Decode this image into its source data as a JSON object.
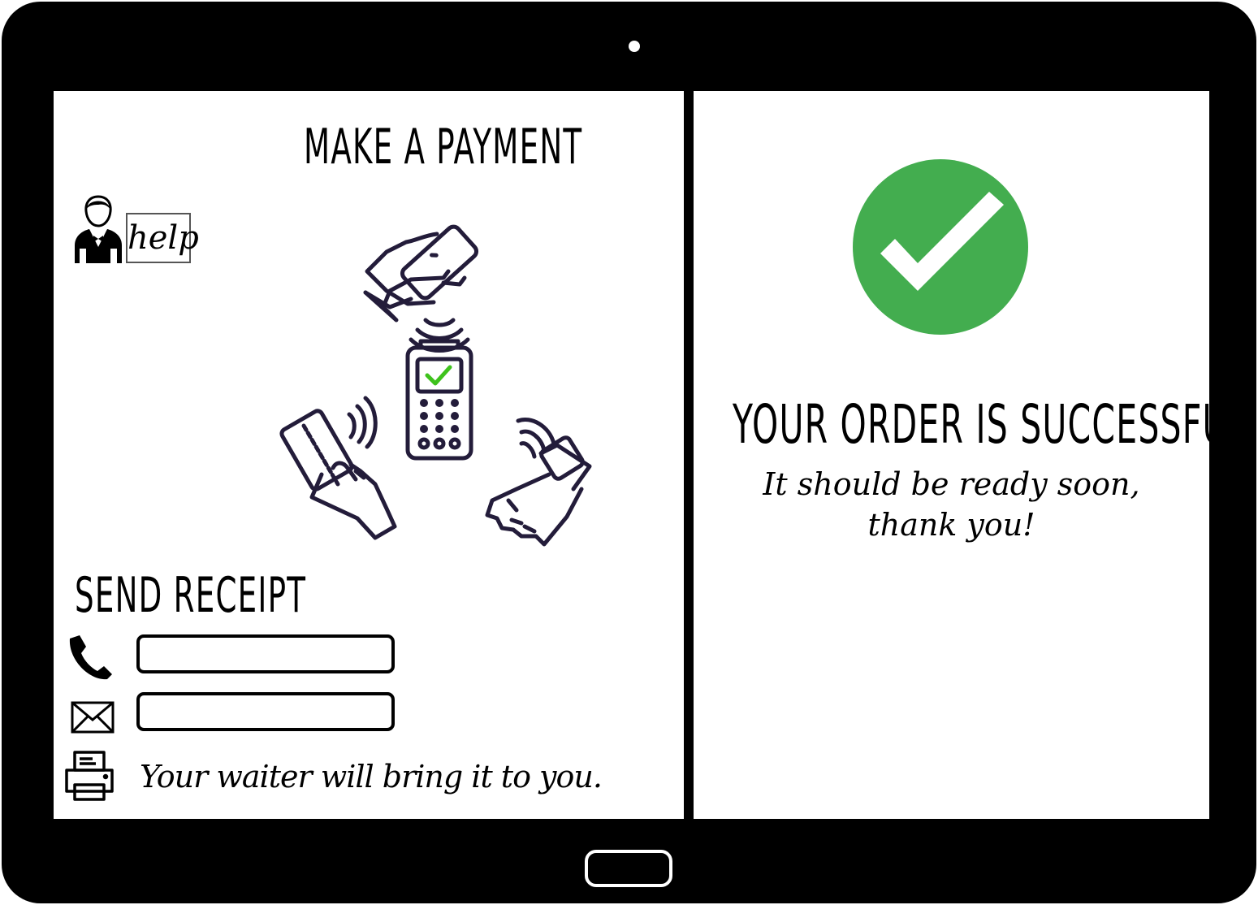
{
  "colors": {
    "device_frame": "#000000",
    "screen_background": "#ffffff",
    "success_green": "#43ad4f",
    "illustration_stroke": "#231c3a",
    "terminal_check": "#3ec21c"
  },
  "payment_screen": {
    "title": "MAKE A PAYMENT",
    "help_label": "help",
    "waiter_icon": "waiter-icon",
    "illustration_icons": [
      "phone-pay-icon",
      "nfc-waves-icon",
      "card-terminal-icon",
      "contactless-card-icon",
      "smartwatch-pay-icon"
    ],
    "receipt": {
      "title": "SEND RECEIPT",
      "phone_field": {
        "icon": "phone-icon",
        "value": "",
        "placeholder": ""
      },
      "email_field": {
        "icon": "mail-icon",
        "value": "",
        "placeholder": ""
      },
      "print": {
        "icon": "printer-icon",
        "note": "Your waiter will bring it to you."
      }
    }
  },
  "confirmation_screen": {
    "icon": "checkmark-circle-icon",
    "title": "YOUR ORDER IS SUCCESSFUL",
    "message_line1": "It should be ready soon,",
    "message_line2": "thank you!"
  }
}
